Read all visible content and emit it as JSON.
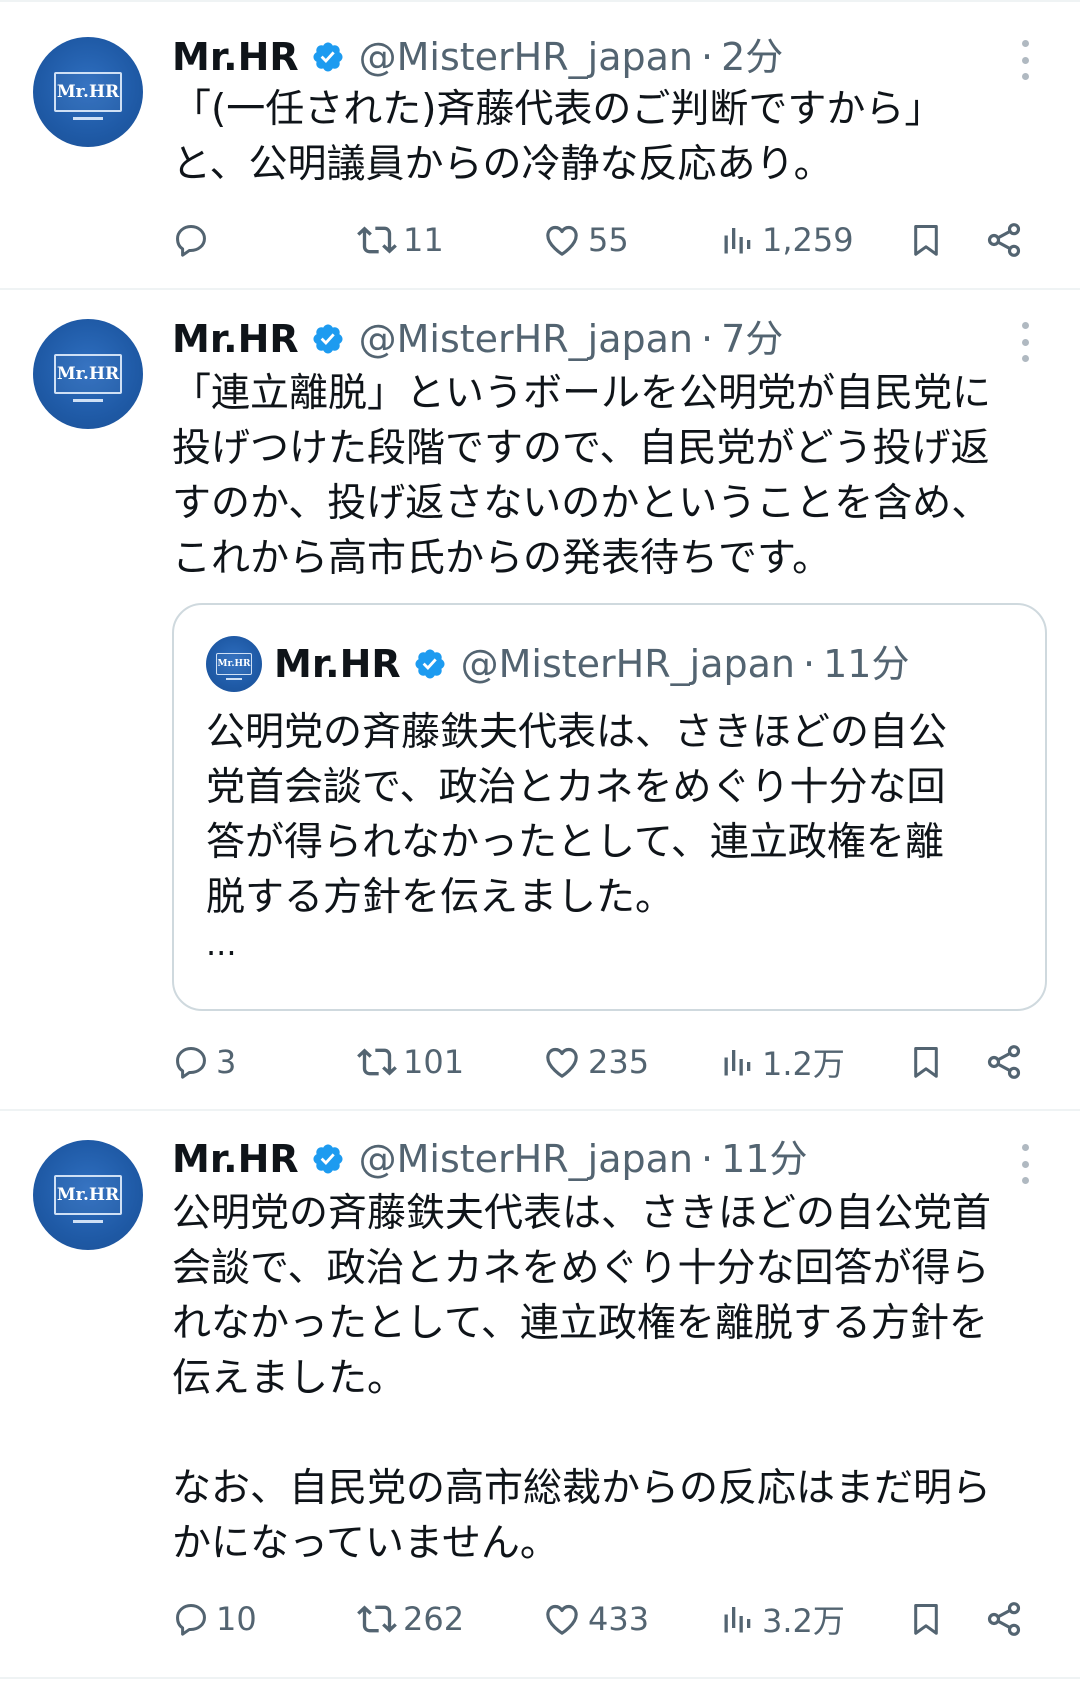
{
  "author": {
    "name": "Mr.HR",
    "handle": "@MisterHR_japan",
    "avatar_text": "Mr.HR"
  },
  "separator": "·",
  "colors": {
    "verified": "#1d9bf0",
    "avatar": "#1f5aa6",
    "secondary_text": "#536471",
    "divider": "#eff3f4"
  },
  "tweets": [
    {
      "time": "2分",
      "text": "「(一任された)斉藤代表のご判断ですから」\nと、公明議員からの冷静な反応あり。",
      "replies": "",
      "retweets": "11",
      "likes": "55",
      "views": "1,259"
    },
    {
      "time": "7分",
      "text": "「連立離脱」というボールを公明党が自民党に\n投げつけた段階ですので、自民党がどう投げ返\nすのか、投げ返さないのかということを含め、\nこれから高市氏からの発表待ちです。",
      "quote": {
        "time": "11分",
        "text": "公明党の斉藤鉄夫代表は、さきほどの自公\n党首会談で、政治とカネをめぐり十分な回\n答が得られなかったとして、連立政権を離\n脱する方針を伝えました。",
        "ellipsis": "..."
      },
      "replies": "3",
      "retweets": "101",
      "likes": "235",
      "views": "1.2万"
    },
    {
      "time": "11分",
      "text": "公明党の斉藤鉄夫代表は、さきほどの自公党首\n会談で、政治とカネをめぐり十分な回答が得ら\nれなかったとして、連立政権を離脱する方針を\n伝えました。\n\nなお、自民党の高市総裁からの反応はまだ明ら\nかになっていません。",
      "replies": "10",
      "retweets": "262",
      "likes": "433",
      "views": "3.2万"
    }
  ],
  "icons": [
    "verified-badge-icon",
    "more-icon",
    "reply-icon",
    "retweet-icon",
    "like-icon",
    "views-icon",
    "bookmark-icon",
    "share-icon"
  ]
}
